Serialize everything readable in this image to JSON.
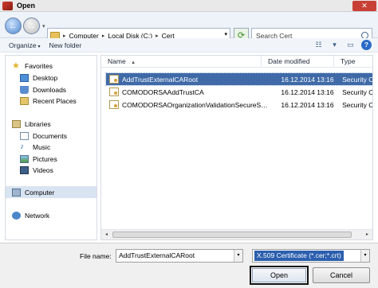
{
  "window": {
    "title": "Open",
    "close_label": "✕"
  },
  "nav": {
    "back_label": "←",
    "forward_label": "→",
    "dropdown_label": "▾"
  },
  "address": {
    "crumbs": [
      "Computer",
      "Local Disk (C:)",
      "Cert"
    ],
    "separator": "▸",
    "dropdown_label": "▾"
  },
  "refresh_label": "⟳",
  "search": {
    "placeholder": "Search Cert"
  },
  "toolbar": {
    "organize_label": "Organize",
    "new_folder_label": "New folder",
    "caret": "▾",
    "view_icon": "☷",
    "preview_icon": "▭",
    "help_icon": "?"
  },
  "navpane": {
    "favorites_label": "Favorites",
    "favorites": [
      "Desktop",
      "Downloads",
      "Recent Places"
    ],
    "libraries_label": "Libraries",
    "libraries": [
      "Documents",
      "Music",
      "Pictures",
      "Videos"
    ],
    "computer_label": "Computer",
    "network_label": "Network"
  },
  "filelist": {
    "columns": [
      "Name",
      "Date modified",
      "Type"
    ],
    "sort_indicator": "▲",
    "rows": [
      {
        "name": "AddTrustExternalCARoot",
        "date": "16.12.2014 13:16",
        "type": "Security Certificate",
        "selected": true
      },
      {
        "name": "COMODORSAAddTrustCA",
        "date": "16.12.2014 13:16",
        "type": "Security Certificate",
        "selected": false
      },
      {
        "name": "COMODORSAOrganizationValidationSecureServerCA",
        "date": "16.12.2014 13:16",
        "type": "Security Certificate",
        "selected": false
      }
    ]
  },
  "scroll": {
    "left_label": "◂",
    "right_label": "▸"
  },
  "footer": {
    "filename_label": "File name:",
    "filename_value": "AddTrustExternalCARoot",
    "filetype_value": "X.509 Certificate (*.cer;*.crt)",
    "dropdown_label": "▾",
    "open_label": "Open",
    "cancel_label": "Cancel"
  },
  "colors": {
    "selection": "#3f6aa7",
    "close": "#c84035",
    "nav_back": "#4a86d2"
  }
}
